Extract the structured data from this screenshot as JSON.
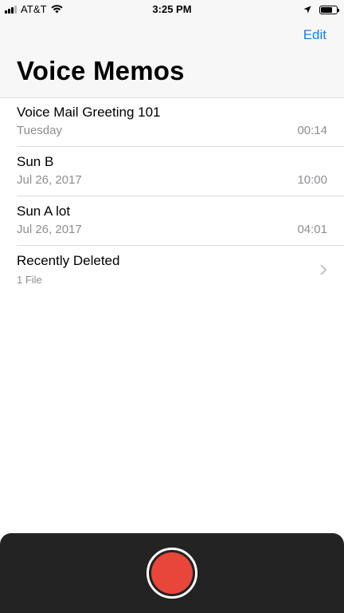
{
  "status_bar": {
    "carrier": "AT&T",
    "time": "3:25 PM",
    "icons": [
      "signal-icon",
      "wifi-icon",
      "location-arrow-icon",
      "battery-icon"
    ]
  },
  "nav": {
    "edit_label": "Edit"
  },
  "page": {
    "title": "Voice Memos"
  },
  "memos": [
    {
      "title": "Voice Mail Greeting 101",
      "date": "Tuesday",
      "duration": "00:14"
    },
    {
      "title": "Sun B",
      "date": "Jul 26, 2017",
      "duration": "10:00"
    },
    {
      "title": "Sun A lot",
      "date": "Jul 26, 2017",
      "duration": "04:01"
    }
  ],
  "recently_deleted": {
    "title": "Recently Deleted",
    "count": "1 File",
    "icon": "chevron-right-icon"
  },
  "record": {
    "icon": "record-icon"
  },
  "colors": {
    "accent": "#1a7cf5",
    "record_red": "#e8463a",
    "panel_dark": "#232323",
    "secondary_text": "#8e8e93"
  }
}
